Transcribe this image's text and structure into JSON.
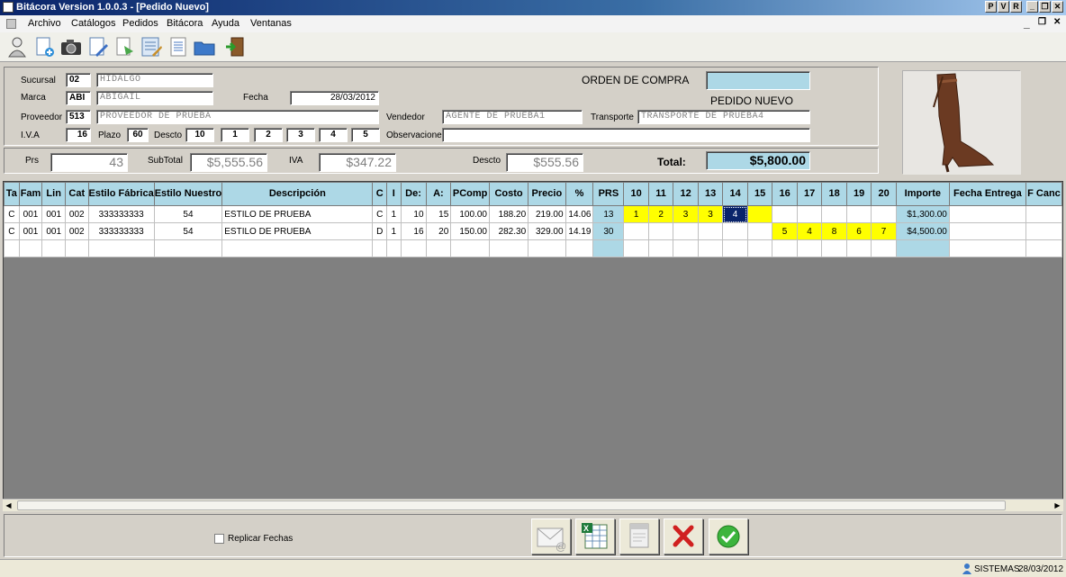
{
  "window": {
    "title": "Bitácora Version 1.0.0.3 - [Pedido Nuevo]",
    "buttons": [
      "P",
      "V",
      "R",
      "_",
      "❐",
      "✕"
    ]
  },
  "menu": {
    "items": [
      "Archivo",
      "Catálogos",
      "Pedidos",
      "Bitácora",
      "Ayuda",
      "Ventanas"
    ],
    "mdi_controls": [
      "_",
      "❐",
      "✕"
    ]
  },
  "toolbar": {
    "tools": [
      "user-icon",
      "new-document-icon",
      "camera-icon",
      "edit-document-icon",
      "import-icon",
      "form-icon",
      "list-icon",
      "folder-icon",
      "exit-door-icon"
    ]
  },
  "header": {
    "sucursal_label": "Sucursal",
    "sucursal_code": "02",
    "sucursal_name": "HIDALGO",
    "marca_label": "Marca",
    "marca_code": "ABI",
    "marca_name": "ABIGAIL",
    "fecha_label": "Fecha",
    "fecha": "28/03/2012",
    "proveedor_label": "Proveedor",
    "proveedor_code": "513",
    "proveedor_name": "PROVEEDOR DE PRUEBA",
    "vendedor_label": "Vendedor",
    "vendedor": "AGENTE DE PRUEBA1",
    "transporte_label": "Transporte",
    "transporte": "TRANSPORTE DE PRUEBA4",
    "iva_label": "I.V.A",
    "iva": "16",
    "plazo_label": "Plazo",
    "plazo": "60",
    "descto_label": "Descto",
    "descto": [
      "10",
      "1",
      "2",
      "3",
      "4",
      "5"
    ],
    "observaciones_label": "Observaciones",
    "observaciones": "",
    "orden_label": "ORDEN DE COMPRA",
    "orden": "",
    "status": "PEDIDO NUEVO"
  },
  "totals": {
    "prs_label": "Prs",
    "prs": "43",
    "subtotal_label": "SubTotal",
    "subtotal": "$5,555.56",
    "iva_label": "IVA",
    "iva": "$347.22",
    "descto_label": "Descto",
    "descto": "$555.56",
    "total_label": "Total:",
    "total": "$5,800.00"
  },
  "grid": {
    "columns": [
      "Ta",
      "Fam",
      "Lin",
      "Cat",
      "Estilo Fábrica",
      "Estilo Nuestro",
      "Descripción",
      "C",
      "I",
      "De:",
      "A:",
      "PComp",
      "Costo",
      "Precio",
      "%",
      "PRS",
      "10",
      "11",
      "12",
      "13",
      "14",
      "15",
      "16",
      "17",
      "18",
      "19",
      "20",
      "Importe",
      "Fecha Entrega",
      "F Canc"
    ],
    "rows": [
      [
        "C",
        "001",
        "001",
        "002",
        "333333333",
        "54",
        "ESTILO DE PRUEBA",
        "C",
        "1",
        "10",
        "15",
        "100.00",
        "188.20",
        "219.00",
        "14.06",
        "13",
        "1",
        "2",
        "3",
        "3",
        "4",
        "",
        "",
        "",
        "",
        "",
        "",
        "$1,300.00",
        "",
        ""
      ],
      [
        "C",
        "001",
        "001",
        "002",
        "333333333",
        "54",
        "ESTILO DE PRUEBA",
        "D",
        "1",
        "16",
        "20",
        "150.00",
        "282.30",
        "329.00",
        "14.19",
        "30",
        "",
        "",
        "",
        "",
        "",
        "",
        "5",
        "4",
        "8",
        "6",
        "7",
        "$4,500.00",
        "",
        ""
      ],
      [
        "",
        "",
        "",
        "",
        "",
        "",
        "",
        "",
        "",
        "",
        "",
        "",
        "",
        "",
        "",
        "",
        "",
        "",
        "",
        "",
        "",
        "",
        "",
        "",
        "",
        "",
        "",
        "",
        "",
        ""
      ]
    ],
    "highlight": {
      "yellow": "#ffff00",
      "blue": "#add8e6",
      "selected": "#0a246a"
    }
  },
  "bottom": {
    "replicar_label": "Replicar Fechas",
    "replicar_checked": false,
    "actions": [
      "email-icon",
      "excel-icon",
      "pdf-icon",
      "cancel-icon",
      "accept-icon"
    ]
  },
  "status": {
    "user": "SISTEMAS",
    "date": "28/03/2012"
  }
}
